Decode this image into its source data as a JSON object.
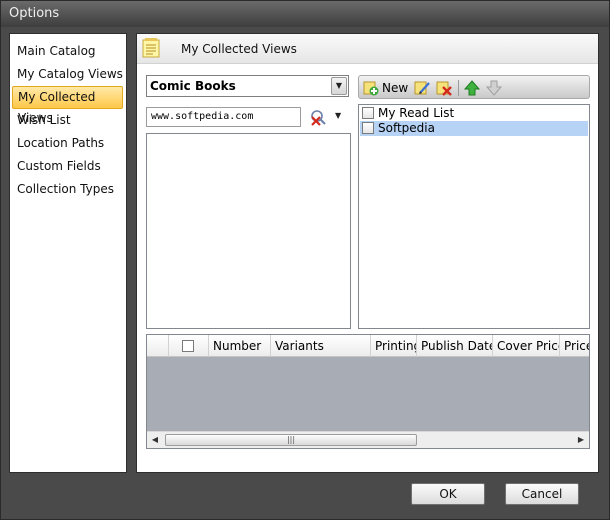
{
  "window": {
    "title": "Options"
  },
  "nav": {
    "items": [
      {
        "label": "Main Catalog"
      },
      {
        "label": "My Catalog Views"
      },
      {
        "label": "My Collected Views",
        "active": true
      },
      {
        "label": "Wish List"
      },
      {
        "label": "Location Paths"
      },
      {
        "label": "Custom Fields"
      },
      {
        "label": "Collection Types"
      }
    ]
  },
  "panel": {
    "title": "My Collected Views",
    "icon": "notepad-icon"
  },
  "combo": {
    "value": "Comic Books"
  },
  "search": {
    "value": "www.softpedia.com"
  },
  "toolbar": {
    "new_label": "New",
    "icons": [
      "new-add-icon",
      "edit-pencil-icon",
      "delete-icon",
      "move-up-arrow-icon",
      "move-down-arrow-icon"
    ]
  },
  "views_list": {
    "items": [
      {
        "label": "My Read List",
        "checked": false,
        "selected": false
      },
      {
        "label": "Softpedia",
        "checked": false,
        "selected": true
      }
    ]
  },
  "grid": {
    "columns": [
      "Number",
      "Variants",
      "Printing",
      "Publish Date",
      "Cover Price",
      "Price"
    ]
  },
  "buttons": {
    "ok": "OK",
    "cancel": "Cancel"
  },
  "colors": {
    "active_nav": "#ffc84a",
    "selection": "#b6d3f5",
    "grid_bg": "#a8acb4"
  }
}
